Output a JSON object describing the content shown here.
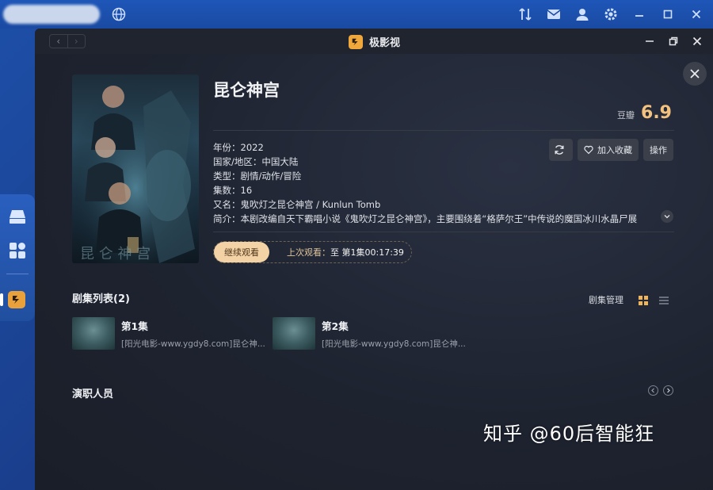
{
  "app": {
    "title": "极影视",
    "nav_back": "‹",
    "nav_forward": "›"
  },
  "detail": {
    "title": "昆仑神宫",
    "rating_label": "豆瓣",
    "rating_value": "6.9",
    "meta": {
      "year": "年份：2022",
      "region": "国家/地区：中国大陆",
      "genre": "类型：剧情/动作/冒险",
      "episodes": "集数：16",
      "alias": "又名：鬼吹灯之昆仑神宫 / Kunlun Tomb",
      "synopsis": "简介：本剧改编自天下霸唱小说《鬼吹灯之昆仑神宫》，主要围绕着“格萨尔王”中传说的魔国冰川水晶尸展"
    },
    "actions": {
      "refresh_label": "",
      "favorite_label": "加入收藏",
      "operate_label": "操作"
    },
    "continue": {
      "button_label": "继续观看",
      "last_label": "上次观看：",
      "last_value": "至 第1集00:17:39"
    }
  },
  "episodes_section": {
    "title": "剧集列表(2)",
    "manage_label": "剧集管理",
    "items": [
      {
        "name": "第1集",
        "file": "[阳光电影-www.ygdy8.com]昆仑神..."
      },
      {
        "name": "第2集",
        "file": "[阳光电影-www.ygdy8.com]昆仑神..."
      }
    ]
  },
  "cast_section": {
    "title": "演职人员"
  },
  "watermark": "知乎 @60后智能狂",
  "colors": {
    "accent_gold": "#f3c27e",
    "continue_button": "#f3d2a6",
    "app_logo": "#f0a83c",
    "desktop_blue": "#1d4fa8"
  }
}
